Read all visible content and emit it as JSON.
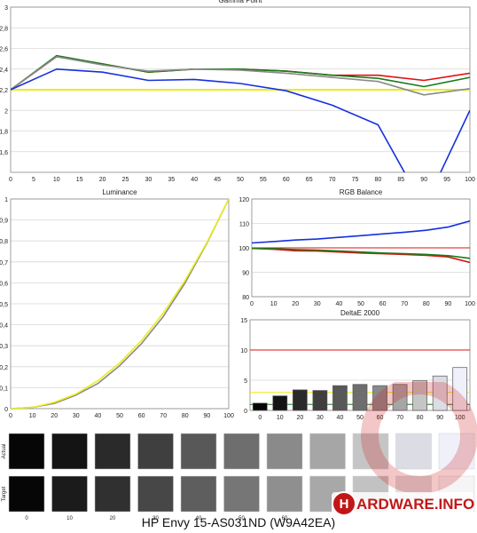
{
  "colors": {
    "red": "#e01010",
    "green": "#1a7a1a",
    "blue": "#1530e0",
    "gray": "#8a8a8a",
    "yellow": "#ecec1a",
    "grid": "#d8d8d8"
  },
  "chart_data": [
    {
      "id": "gamma",
      "type": "line",
      "title": "Gamma Point",
      "x": [
        0,
        10,
        20,
        30,
        40,
        50,
        60,
        70,
        80,
        90,
        100
      ],
      "xticks": [
        "0",
        "5",
        "10",
        "15",
        "20",
        "25",
        "30",
        "35",
        "40",
        "45",
        "50",
        "55",
        "60",
        "65",
        "70",
        "75",
        "80",
        "85",
        "90",
        "95",
        "100"
      ],
      "yticks": [
        "1,6",
        "1,8",
        "2",
        "2,2",
        "2,4",
        "2,6",
        "2,8",
        "3"
      ],
      "ylim": [
        1.4,
        3.0
      ],
      "xlim": [
        0,
        100
      ],
      "target": 2.2,
      "series": [
        {
          "color": "red",
          "values": [
            2.2,
            2.52,
            2.45,
            2.37,
            2.4,
            2.4,
            2.38,
            2.34,
            2.34,
            2.29,
            2.36
          ]
        },
        {
          "color": "green",
          "values": [
            2.2,
            2.53,
            2.45,
            2.37,
            2.4,
            2.4,
            2.38,
            2.34,
            2.31,
            2.23,
            2.32
          ]
        },
        {
          "color": "gray",
          "values": [
            2.2,
            2.52,
            2.44,
            2.38,
            2.4,
            2.39,
            2.36,
            2.32,
            2.28,
            2.15,
            2.21
          ]
        },
        {
          "color": "blue",
          "values": [
            2.2,
            2.4,
            2.37,
            2.29,
            2.3,
            2.26,
            2.19,
            2.05,
            1.86,
            1.06,
            2.0
          ]
        }
      ]
    },
    {
      "id": "luminance",
      "type": "line",
      "title": "Luminance",
      "x": [
        0,
        10,
        20,
        30,
        40,
        50,
        60,
        70,
        80,
        90,
        100
      ],
      "xticks": [
        "0",
        "10",
        "20",
        "30",
        "40",
        "50",
        "60",
        "70",
        "80",
        "90",
        "100"
      ],
      "yticks": [
        "0",
        "0,1",
        "0,2",
        "0,3",
        "0,4",
        "0,5",
        "0,6",
        "0,7",
        "0,8",
        "0,9",
        "1"
      ],
      "ylim": [
        0,
        1
      ],
      "xlim": [
        0,
        100
      ],
      "series": [
        {
          "color": "gray",
          "values": [
            0,
            0.006,
            0.025,
            0.065,
            0.12,
            0.205,
            0.31,
            0.44,
            0.6,
            0.79,
            1.0
          ]
        },
        {
          "color": "yellow",
          "values": [
            0,
            0.006,
            0.03,
            0.07,
            0.133,
            0.218,
            0.325,
            0.456,
            0.612,
            0.793,
            1.0
          ]
        }
      ]
    },
    {
      "id": "rgb",
      "type": "line",
      "title": "RGB Balance",
      "x": [
        0,
        10,
        20,
        30,
        40,
        50,
        60,
        70,
        80,
        90,
        100
      ],
      "xticks": [
        "0",
        "10",
        "20",
        "30",
        "40",
        "50",
        "60",
        "70",
        "80",
        "90",
        "100"
      ],
      "yticks": [
        "80",
        "90",
        "100",
        "110",
        "120"
      ],
      "ylim": [
        80,
        120
      ],
      "xlim": [
        0,
        100
      ],
      "target": 100,
      "series": [
        {
          "color": "red",
          "values": [
            99.8,
            99.4,
            98.8,
            98.7,
            98.3,
            97.9,
            97.6,
            97.3,
            96.9,
            96.3,
            94.0
          ]
        },
        {
          "color": "green",
          "values": [
            99.9,
            99.6,
            99.3,
            99.1,
            98.7,
            98.3,
            97.9,
            97.6,
            97.3,
            96.8,
            95.7
          ]
        },
        {
          "color": "blue",
          "values": [
            102.0,
            102.6,
            103.2,
            103.6,
            104.3,
            105.0,
            105.7,
            106.4,
            107.2,
            108.5,
            111.0
          ]
        }
      ]
    },
    {
      "id": "delta",
      "type": "bar",
      "title": "DeltaE 2000",
      "categories": [
        "0",
        "10",
        "20",
        "30",
        "40",
        "50",
        "60",
        "70",
        "80",
        "90",
        "100"
      ],
      "values": [
        1.2,
        2.4,
        3.4,
        3.3,
        4.1,
        4.3,
        4.1,
        4.3,
        4.9,
        5.7,
        7.1
      ],
      "yticks": [
        "0",
        "5",
        "10",
        "15"
      ],
      "ylim": [
        0,
        15
      ],
      "thresholds": [
        {
          "value": 10,
          "color": "red"
        },
        {
          "value": 3,
          "color": "yellow"
        },
        {
          "value": 1,
          "color": "green"
        }
      ]
    },
    {
      "id": "swatches",
      "type": "table",
      "row_labels": [
        "Actual",
        "Target"
      ],
      "labels": [
        "0",
        "10",
        "20",
        "30",
        "40",
        "50",
        "60",
        "70",
        "80",
        "90",
        "100"
      ],
      "visible_labels": 7,
      "actual": [
        "#060606",
        "#141414",
        "#2a2a2a",
        "#3f3f3f",
        "#585858",
        "#6e6e6e",
        "#8a8a8a",
        "#a6a6a6",
        "#c5c5c5",
        "#dcdce4",
        "#f0f0fa"
      ],
      "target": [
        "#060606",
        "#1b1b1b",
        "#303030",
        "#474747",
        "#5e5e5e",
        "#767676",
        "#8f8f8f",
        "#a8a8a8",
        "#c2c2c2",
        "#dcdcdc",
        "#f5f5f5"
      ]
    }
  ],
  "watermark": {
    "brand_letter": "H",
    "brand_text": "ARDWARE.INFO"
  },
  "caption": "HP Envy 15-AS031ND (W9A42EA)"
}
